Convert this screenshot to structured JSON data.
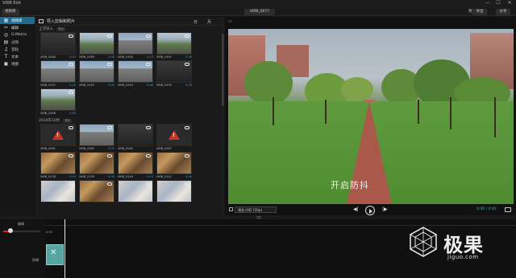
{
  "app": {
    "title": "VIRB Edit",
    "window_controls": [
      "—",
      "☐",
      "✕"
    ]
  },
  "toolbar": {
    "project_tab": "视频库",
    "center_title": "VIRB_0077",
    "user": "我账",
    "btn_import": "导出",
    "btn_share": "分享"
  },
  "sidebar": {
    "items": [
      {
        "label": "视频库",
        "icon": "grid-icon",
        "active": true
      },
      {
        "label": "编辑",
        "icon": "scissors-icon",
        "active": false
      },
      {
        "label": "G-Metrix",
        "icon": "gauge-icon",
        "active": false
      },
      {
        "label": "过场",
        "icon": "film-icon",
        "active": false
      },
      {
        "label": "音轨",
        "icon": "music-icon",
        "active": false
      },
      {
        "label": "文本",
        "icon": "text-icon",
        "active": false
      },
      {
        "label": "地图",
        "icon": "map-icon",
        "active": false
      }
    ]
  },
  "media": {
    "header_title": "导入剪辑和照片",
    "view_day": "日",
    "view_month": "月",
    "section1": {
      "title": "上次导入",
      "tag": "清除"
    },
    "grid1": [
      {
        "name": "VIRB_0488",
        "dur": "0:02",
        "style": "dark"
      },
      {
        "name": "VIRB_0489",
        "dur": "0:08",
        "style": "trees"
      },
      {
        "name": "VIRB_0490",
        "dur": "0:23",
        "style": "road"
      },
      {
        "name": "VIRB_0491",
        "dur": "0:38",
        "style": "trees"
      },
      {
        "name": "VIRB_0492",
        "dur": "0:42",
        "style": "road"
      },
      {
        "name": "VIRB_0493",
        "dur": "0:40",
        "style": "road"
      },
      {
        "name": "VIRB_0494",
        "dur": "0:48",
        "style": "road"
      },
      {
        "name": "VIRB_0495",
        "dur": "0:34",
        "style": "dark"
      },
      {
        "name": "VIRB_0496",
        "dur": "0:30",
        "style": "trees"
      }
    ],
    "section2": {
      "title": "2016年10月",
      "tag": "清除"
    },
    "grid2": [
      {
        "name": "VIRB_0081",
        "dur": "",
        "style": "warn"
      },
      {
        "name": "VIRB_0082",
        "dur": "0:31",
        "style": "road"
      },
      {
        "name": "VIRB_0085",
        "dur": "",
        "style": "dark"
      },
      {
        "name": "VIRB_0087",
        "dur": "",
        "style": "warn"
      },
      {
        "name": "VIRB_0138",
        "dur": "0:05",
        "style": "shop"
      },
      {
        "name": "VIRB_0139",
        "dur": "0:36",
        "style": "shop"
      },
      {
        "name": "VIRB_0140",
        "dur": "0:13",
        "style": "shop"
      },
      {
        "name": "VIRB_0141",
        "dur": "0:05",
        "style": "shop"
      },
      {
        "name": "",
        "dur": "",
        "style": "store"
      },
      {
        "name": "",
        "dur": "",
        "style": "shop"
      },
      {
        "name": "",
        "dur": "",
        "style": "store"
      },
      {
        "name": "",
        "dur": "",
        "style": "store"
      }
    ]
  },
  "preview": {
    "subtitle": "开启防抖",
    "quality": "预览 (HD 720p)",
    "time": "0:40 / 0:40"
  },
  "timeline": {
    "track_label": "编辑",
    "clip_time": "0:00",
    "track2_label": "剪辑"
  },
  "watermark": {
    "brand": "极果",
    "url": "jiguo.com"
  },
  "colors": {
    "accent": "#1f6b8f",
    "time": "#3aa7c9",
    "clip": "#57a5a0"
  }
}
